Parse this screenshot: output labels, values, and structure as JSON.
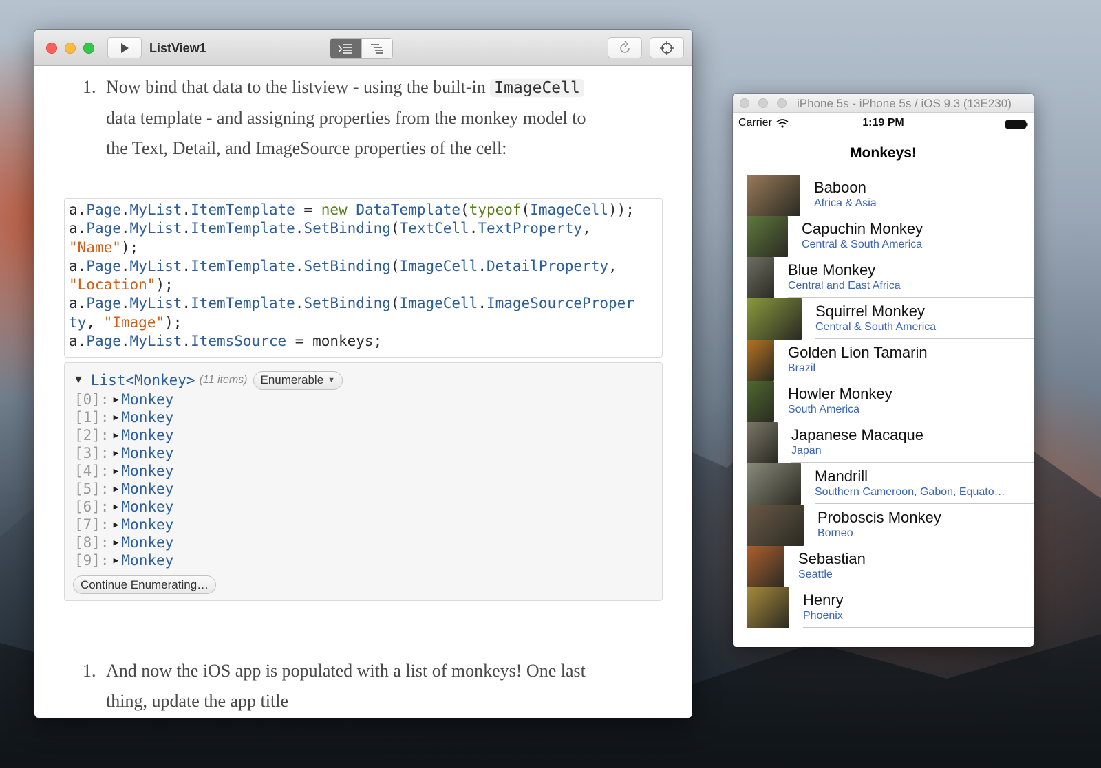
{
  "playground": {
    "title": "ListView1",
    "step1": {
      "number": "1.",
      "text_before": "Now bind that data to the listview - using the built-in ",
      "code": "ImageCell",
      "line2": "data template - and assigning properties from the monkey model to",
      "line3": "the Text, Detail, and ImageSource properties of the cell:"
    },
    "code_lines": [
      [
        {
          "t": "a",
          "c": ""
        },
        {
          "t": ".",
          "c": ""
        },
        {
          "t": "Page",
          "c": "k"
        },
        {
          "t": ".",
          "c": ""
        },
        {
          "t": "MyList",
          "c": "k"
        },
        {
          "t": ".",
          "c": ""
        },
        {
          "t": "ItemTemplate",
          "c": "k"
        },
        {
          "t": " = ",
          "c": ""
        },
        {
          "t": "new",
          "c": "t"
        },
        {
          "t": " ",
          "c": ""
        },
        {
          "t": "DataTemplate",
          "c": "k"
        },
        {
          "t": "(",
          "c": ""
        },
        {
          "t": "typeof",
          "c": "t"
        },
        {
          "t": "(",
          "c": ""
        },
        {
          "t": "ImageCell",
          "c": "k"
        },
        {
          "t": "));",
          "c": ""
        }
      ],
      [
        {
          "t": "a",
          "c": ""
        },
        {
          "t": ".",
          "c": ""
        },
        {
          "t": "Page",
          "c": "k"
        },
        {
          "t": ".",
          "c": ""
        },
        {
          "t": "MyList",
          "c": "k"
        },
        {
          "t": ".",
          "c": ""
        },
        {
          "t": "ItemTemplate",
          "c": "k"
        },
        {
          "t": ".",
          "c": ""
        },
        {
          "t": "SetBinding",
          "c": "k"
        },
        {
          "t": "(",
          "c": ""
        },
        {
          "t": "TextCell",
          "c": "k"
        },
        {
          "t": ".",
          "c": ""
        },
        {
          "t": "TextProperty",
          "c": "k"
        },
        {
          "t": ",",
          "c": ""
        }
      ],
      [
        {
          "t": "\"Name\"",
          "c": "s"
        },
        {
          "t": ");",
          "c": ""
        }
      ],
      [
        {
          "t": "a",
          "c": ""
        },
        {
          "t": ".",
          "c": ""
        },
        {
          "t": "Page",
          "c": "k"
        },
        {
          "t": ".",
          "c": ""
        },
        {
          "t": "MyList",
          "c": "k"
        },
        {
          "t": ".",
          "c": ""
        },
        {
          "t": "ItemTemplate",
          "c": "k"
        },
        {
          "t": ".",
          "c": ""
        },
        {
          "t": "SetBinding",
          "c": "k"
        },
        {
          "t": "(",
          "c": ""
        },
        {
          "t": "ImageCell",
          "c": "k"
        },
        {
          "t": ".",
          "c": ""
        },
        {
          "t": "DetailProperty",
          "c": "k"
        },
        {
          "t": ",",
          "c": ""
        }
      ],
      [
        {
          "t": "\"Location\"",
          "c": "s"
        },
        {
          "t": ");",
          "c": ""
        }
      ],
      [
        {
          "t": "a",
          "c": ""
        },
        {
          "t": ".",
          "c": ""
        },
        {
          "t": "Page",
          "c": "k"
        },
        {
          "t": ".",
          "c": ""
        },
        {
          "t": "MyList",
          "c": "k"
        },
        {
          "t": ".",
          "c": ""
        },
        {
          "t": "ItemTemplate",
          "c": "k"
        },
        {
          "t": ".",
          "c": ""
        },
        {
          "t": "SetBinding",
          "c": "k"
        },
        {
          "t": "(",
          "c": ""
        },
        {
          "t": "ImageCell",
          "c": "k"
        },
        {
          "t": ".",
          "c": ""
        },
        {
          "t": "ImageSourceProper",
          "c": "k"
        }
      ],
      [
        {
          "t": "ty",
          "c": "k"
        },
        {
          "t": ", ",
          "c": ""
        },
        {
          "t": "\"Image\"",
          "c": "s"
        },
        {
          "t": ");",
          "c": ""
        }
      ],
      [
        {
          "t": "a",
          "c": ""
        },
        {
          "t": ".",
          "c": ""
        },
        {
          "t": "Page",
          "c": "k"
        },
        {
          "t": ".",
          "c": ""
        },
        {
          "t": "MyList",
          "c": "k"
        },
        {
          "t": ".",
          "c": ""
        },
        {
          "t": "ItemsSource",
          "c": "k"
        },
        {
          "t": " = monkeys;",
          "c": ""
        }
      ]
    ],
    "result": {
      "type": "List<Monkey>",
      "count": "(11 items)",
      "enum_label": "Enumerable",
      "items": [
        {
          "index": "[0]:",
          "name": "Monkey"
        },
        {
          "index": "[1]:",
          "name": "Monkey"
        },
        {
          "index": "[2]:",
          "name": "Monkey"
        },
        {
          "index": "[3]:",
          "name": "Monkey"
        },
        {
          "index": "[4]:",
          "name": "Monkey"
        },
        {
          "index": "[5]:",
          "name": "Monkey"
        },
        {
          "index": "[6]:",
          "name": "Monkey"
        },
        {
          "index": "[7]:",
          "name": "Monkey"
        },
        {
          "index": "[8]:",
          "name": "Monkey"
        },
        {
          "index": "[9]:",
          "name": "Monkey"
        }
      ],
      "continue_label": "Continue Enumerating…"
    },
    "step2": {
      "number": "1.",
      "line1": "And now the iOS app is populated with a list of monkeys! One last",
      "line2": "thing, update the app title"
    }
  },
  "simulator": {
    "title": "iPhone 5s - iPhone 5s / iOS 9.3 (13E230)",
    "carrier": "Carrier",
    "time": "1:19 PM",
    "nav_title": "Monkeys!",
    "monkeys": [
      {
        "name": "Baboon",
        "detail": "Africa & Asia",
        "color": "#9a7b5a",
        "w": 78
      },
      {
        "name": "Capuchin Monkey",
        "detail": "Central & South America",
        "color": "#5f7a3e",
        "w": 60
      },
      {
        "name": "Blue Monkey",
        "detail": "Central and East Africa",
        "color": "#6f6f64",
        "w": 40
      },
      {
        "name": "Squirrel Monkey",
        "detail": "Central & South America",
        "color": "#8a9a3c",
        "w": 80
      },
      {
        "name": "Golden Lion Tamarin",
        "detail": "Brazil",
        "color": "#b8741e",
        "w": 40
      },
      {
        "name": "Howler Monkey",
        "detail": "South America",
        "color": "#4e6a2e",
        "w": 40
      },
      {
        "name": "Japanese Macaque",
        "detail": "Japan",
        "color": "#7c7669",
        "w": 45
      },
      {
        "name": "Mandrill",
        "detail": "Southern Cameroon, Gabon, Equato…",
        "color": "#8a8a7c",
        "w": 79
      },
      {
        "name": "Proboscis Monkey",
        "detail": "Borneo",
        "color": "#6b5a48",
        "w": 83
      },
      {
        "name": "Sebastian",
        "detail": "Seattle",
        "color": "#b0602e",
        "w": 55
      },
      {
        "name": "Henry",
        "detail": "Phoenix",
        "color": "#a88a3a",
        "w": 62
      }
    ]
  }
}
